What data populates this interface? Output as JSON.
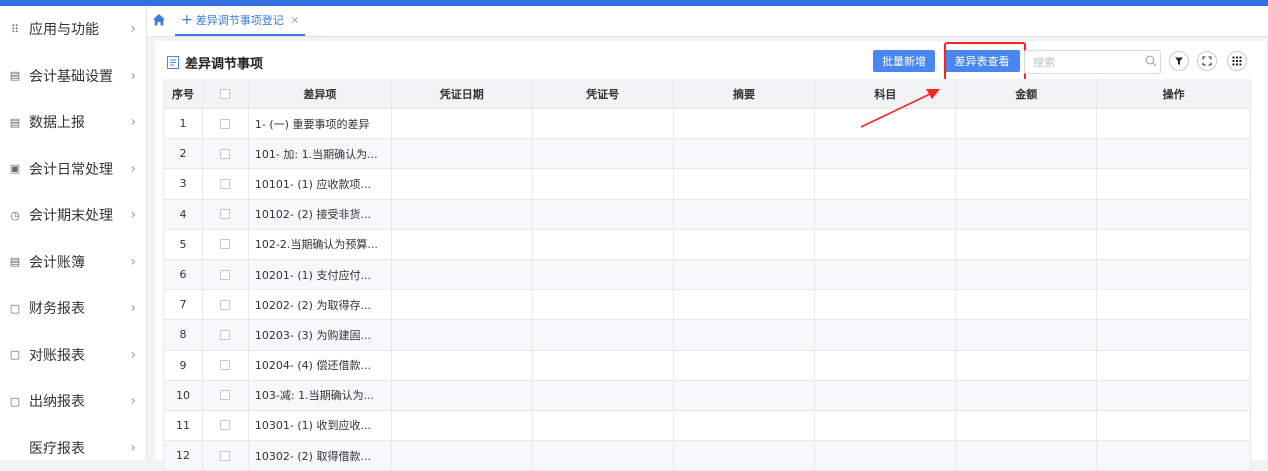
{
  "sidebar": {
    "items": [
      {
        "label": "应用与功能",
        "icon": "grid-dots-icon"
      },
      {
        "label": "会计基础设置",
        "icon": "settings-doc-icon"
      },
      {
        "label": "数据上报",
        "icon": "report-doc-icon"
      },
      {
        "label": "会计日常处理",
        "icon": "id-card-icon"
      },
      {
        "label": "会计期末处理",
        "icon": "clock-circle-icon"
      },
      {
        "label": "会计账簿",
        "icon": "ledger-icon"
      },
      {
        "label": "财务报表",
        "icon": "finance-report-icon"
      },
      {
        "label": "对账报表",
        "icon": "reconcile-report-icon"
      },
      {
        "label": "出纳报表",
        "icon": "cashier-report-icon"
      },
      {
        "label": "医疗报表",
        "icon": ""
      }
    ]
  },
  "tabs": {
    "active": {
      "label": "差异调节事项登记",
      "plus": "+",
      "close": "×"
    }
  },
  "panel": {
    "title": "差异调节事项",
    "batch_add": "批量新增",
    "diff_view": "差异表查看",
    "search_placeholder": "搜索"
  },
  "table": {
    "headers": [
      "序号",
      "",
      "差异项",
      "凭证日期",
      "凭证号",
      "摘要",
      "科目",
      "金额",
      "操作"
    ],
    "rows": [
      {
        "no": "1",
        "item": "1- (一) 重要事项的差异"
      },
      {
        "no": "2",
        "item": "101- 加: 1.当期确认为..."
      },
      {
        "no": "3",
        "item": "10101- (1) 应收款项..."
      },
      {
        "no": "4",
        "item": "10102- (2) 接受非货..."
      },
      {
        "no": "5",
        "item": "102-2.当期确认为预算..."
      },
      {
        "no": "6",
        "item": "10201- (1) 支付应付..."
      },
      {
        "no": "7",
        "item": "10202- (2) 为取得存..."
      },
      {
        "no": "8",
        "item": "10203- (3) 为购建固..."
      },
      {
        "no": "9",
        "item": "10204- (4) 偿还借款..."
      },
      {
        "no": "10",
        "item": "103-减: 1.当期确认为..."
      },
      {
        "no": "11",
        "item": "10301- (1) 收到应收..."
      },
      {
        "no": "12",
        "item": "10302- (2) 取得借款..."
      }
    ]
  },
  "colors": {
    "accent": "#4a86f0",
    "highlight": "#ff2020",
    "topbar": "#2f6fe0"
  }
}
